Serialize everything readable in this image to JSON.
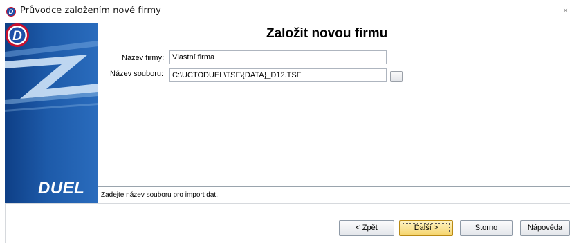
{
  "window": {
    "title": "Průvodce založením nové firmy",
    "close_glyph": "×"
  },
  "sidebar": {
    "brand_letter": "D",
    "brand_name": "DUEL"
  },
  "main": {
    "heading": "Založit novou firmu"
  },
  "form": {
    "company_name": {
      "label_pre": "Název ",
      "label_key": "f",
      "label_post": "irmy:",
      "value": "Vlastní firma"
    },
    "file_name": {
      "label_pre": "Náze",
      "label_key": "v",
      "label_post": " souboru:",
      "value": "C:\\UCTODUEL\\TSF\\{DATA}_D12.TSF"
    },
    "browse_label": "..."
  },
  "status_text": "Zadejte název souboru pro import dat.",
  "buttons": {
    "back": {
      "pre": "< ",
      "key": "Z",
      "post": "pět"
    },
    "next": {
      "pre": "",
      "key": "D",
      "post": "alší >"
    },
    "cancel": {
      "pre": "",
      "key": "S",
      "post": "torno"
    },
    "help": {
      "pre": "",
      "key": "N",
      "post": "ápověda"
    }
  },
  "colors": {
    "brand_blue": "#1e4fa8",
    "brand_red": "#c8102e",
    "default_button": "#f5d46c"
  },
  "icons": [
    "duel-logo-icon",
    "close-icon"
  ]
}
